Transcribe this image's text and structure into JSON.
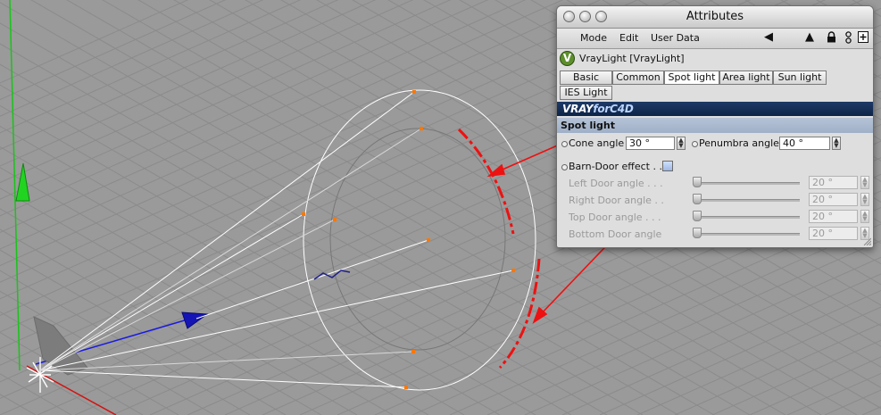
{
  "window": {
    "title": "Attributes"
  },
  "menu": {
    "items": [
      "Mode",
      "Edit",
      "User Data"
    ]
  },
  "object": {
    "name": "VrayLight [VrayLight]",
    "icon_letter": "V"
  },
  "tabs": [
    {
      "label": "Basic",
      "state": "normal"
    },
    {
      "label": "Common",
      "state": "normal"
    },
    {
      "label": "Spot light",
      "state": "active"
    },
    {
      "label": "Area light",
      "state": "normal"
    },
    {
      "label": "Sun light",
      "state": "normal"
    },
    {
      "label": "IES Light",
      "state": "normal"
    }
  ],
  "banner": {
    "logo_left": "VRAY",
    "logo_right": "forC4D"
  },
  "section": {
    "title": "Spot light"
  },
  "fields": {
    "cone_angle": {
      "label": "Cone angle",
      "value": "30 °"
    },
    "penumbra_angle": {
      "label": "Penumbra angle",
      "value": "40 °"
    },
    "barn_door": {
      "label": "Barn-Door effect . ."
    },
    "left_door": {
      "label": "Left Door angle . . .",
      "value": "20 °",
      "slider": 0.0
    },
    "right_door": {
      "label": "Right Door angle . .",
      "value": "20 °",
      "slider": 0.0
    },
    "top_door": {
      "label": "Top Door angle . . .",
      "value": "20 °",
      "slider": 0.0
    },
    "bottom_door": {
      "label": "Bottom Door angle",
      "value": "20 °",
      "slider": 0.0
    }
  },
  "colors": {
    "viewport_bg": "#9a9a9a",
    "grid": "#8b8b8b",
    "wire": "#ffffff",
    "arrow": "#ee1111",
    "handle": "#ff7700",
    "axis_y": "#18c418",
    "axis_z": "#1a1ae0",
    "axis_x": "#d21313"
  },
  "icons": [
    "play-back-icon",
    "pointer-icon",
    "lock-icon",
    "link-icon",
    "new-panel-icon",
    "vraylight-icon"
  ]
}
